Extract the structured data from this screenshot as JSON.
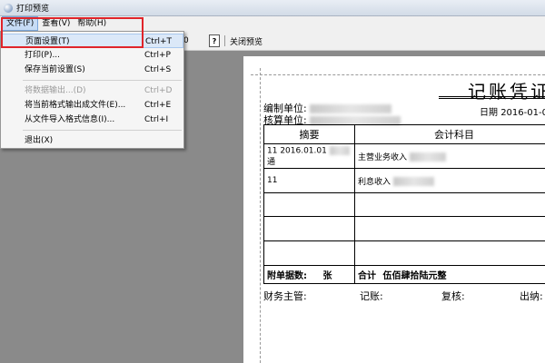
{
  "window": {
    "title": "打印预览"
  },
  "menubar": {
    "items": [
      "文件(F)",
      "查看(V)",
      "帮助(H)"
    ]
  },
  "toolbar": {
    "zoom_glyph": "0",
    "help_label": "?",
    "close_label": "关闭预览"
  },
  "file_menu": {
    "items": [
      {
        "label": "页面设置(T)",
        "shortcut": "Ctrl+T",
        "state": "selected"
      },
      {
        "label": "打印(P)...",
        "shortcut": "Ctrl+P",
        "state": "normal"
      },
      {
        "label": "保存当前设置(S)",
        "shortcut": "Ctrl+S",
        "state": "normal"
      },
      {
        "label": "将数据输出...(D)",
        "shortcut": "Ctrl+D",
        "state": "disabled"
      },
      {
        "label": "将当前格式输出成文件(E)...",
        "shortcut": "Ctrl+E",
        "state": "normal"
      },
      {
        "label": "从文件导入格式信息(I)...",
        "shortcut": "Ctrl+I",
        "state": "normal"
      },
      {
        "label": "退出(X)",
        "shortcut": "",
        "state": "normal"
      }
    ]
  },
  "voucher": {
    "title": "记账凭证",
    "compiler_label": "编制单位:",
    "accounting_label": "核算单位:",
    "date_label": "日期",
    "date_value": "2016-01-0",
    "headers": {
      "summary": "摘要",
      "account": "会计科目"
    },
    "rows": [
      {
        "summary": "11 2016.01.01",
        "summary_line2": "通",
        "account": "主营业务收入"
      },
      {
        "summary": "11",
        "summary_line2": "",
        "account": "利息收入"
      },
      {
        "summary": "",
        "summary_line2": "",
        "account": ""
      },
      {
        "summary": "",
        "summary_line2": "",
        "account": ""
      },
      {
        "summary": "",
        "summary_line2": "",
        "account": ""
      }
    ],
    "attachments_label": "附单据数:",
    "attachments_value": "张",
    "total_label": "合计",
    "total_amount_text": "伍佰肆拾陆元整",
    "signatures": {
      "finance_manager": "财务主管:",
      "bookkeeper": "记账:",
      "reviewer": "复核:",
      "cashier": "出纳:"
    }
  }
}
